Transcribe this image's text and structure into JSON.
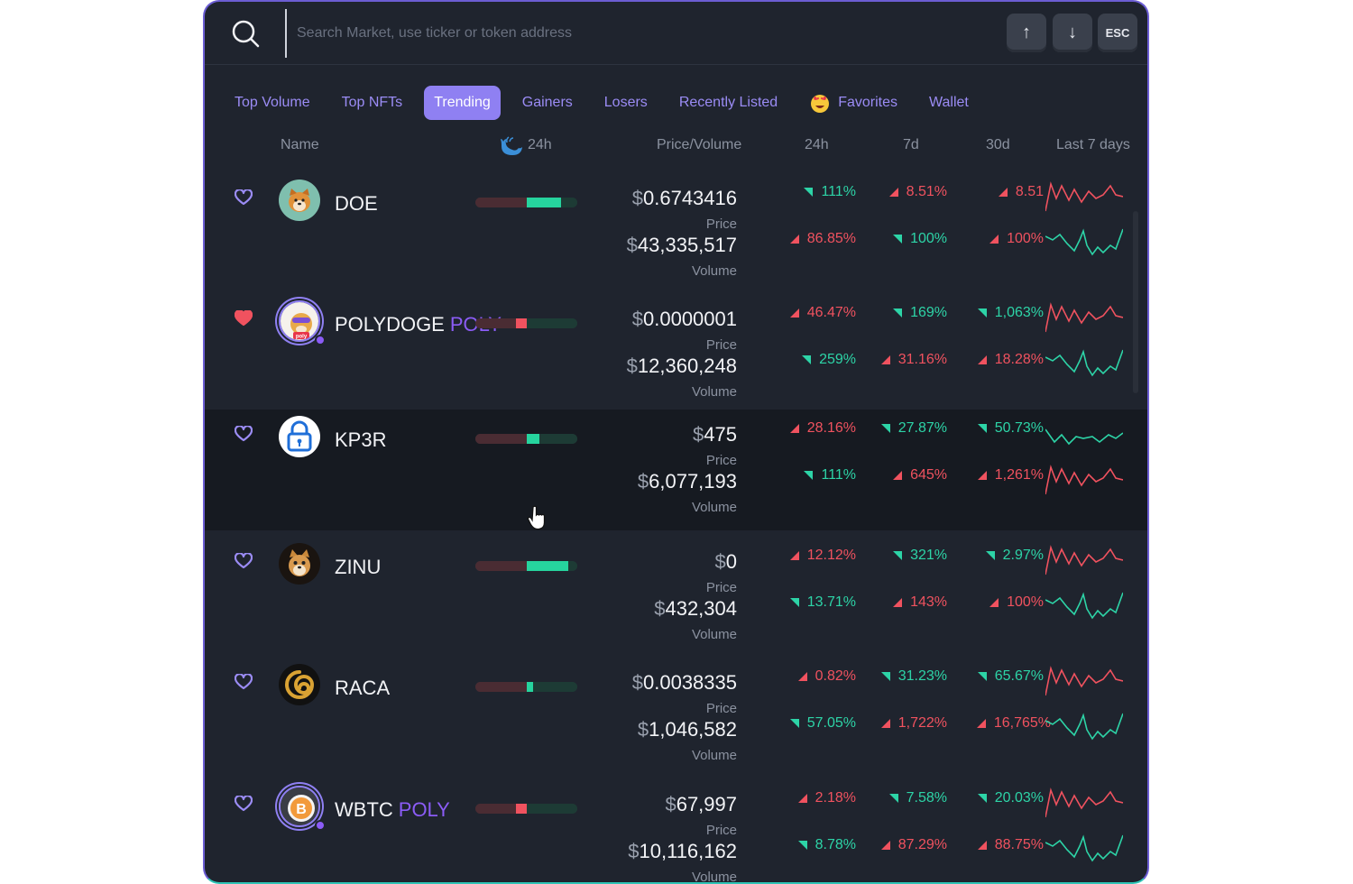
{
  "search": {
    "placeholder": "Search Market, use ticker or token address"
  },
  "keys": {
    "up": "↑",
    "down": "↓",
    "esc": "ESC"
  },
  "tabs": [
    {
      "label": "Top Volume"
    },
    {
      "label": "Top NFTs"
    },
    {
      "label": "Trending",
      "active": true
    },
    {
      "label": "Gainers"
    },
    {
      "label": "Losers"
    },
    {
      "label": "Recently Listed"
    },
    {
      "label": "Favorites",
      "icon": "heart-eyes-emoji-icon"
    },
    {
      "label": "Wallet"
    }
  ],
  "columns": {
    "name": "Name",
    "whale24h": "24h",
    "price_volume": "Price/Volume",
    "d24": "24h",
    "d7": "7d",
    "d30": "30d",
    "last7": "Last 7 days"
  },
  "labels": {
    "price": "Price",
    "volume": "Volume"
  },
  "colors": {
    "accent": "#8f80f2",
    "up": "#2dd4a7",
    "down": "#f0525f",
    "chain": "#8b5cf6",
    "background": "#1f242e"
  },
  "rows": [
    {
      "name": "DOE",
      "chain": "",
      "favorite": false,
      "icon": "shiba-dog-icon",
      "bar_buy_fraction": 0.34,
      "bar_sell_fraction": 0.5,
      "price": "0.6743416",
      "volume": "43,335,517",
      "price_changes": [
        {
          "v": "111%",
          "dir": "up"
        },
        {
          "v": "8.51%",
          "dir": "down"
        },
        {
          "v": "8.51",
          "dir": "down"
        }
      ],
      "volume_changes": [
        {
          "v": "86.85%",
          "dir": "down"
        },
        {
          "v": "100%",
          "dir": "up"
        },
        {
          "v": "100%",
          "dir": "down"
        }
      ],
      "spark_price": "down",
      "spark_volume": "up"
    },
    {
      "name": "POLYDOGE",
      "chain": "POLY",
      "favorite": true,
      "icon": "polydoge-icon",
      "bar_buy_fraction": 0.0,
      "bar_sell_fraction": 0.5,
      "price": "0.0000001",
      "volume": "12,360,248",
      "price_changes": [
        {
          "v": "46.47%",
          "dir": "down"
        },
        {
          "v": "169%",
          "dir": "up"
        },
        {
          "v": "1,063%",
          "dir": "up"
        }
      ],
      "volume_changes": [
        {
          "v": "259%",
          "dir": "up"
        },
        {
          "v": "31.16%",
          "dir": "down"
        },
        {
          "v": "18.28%",
          "dir": "down"
        }
      ],
      "spark_price": "down",
      "spark_volume": "up"
    },
    {
      "name": "KP3R",
      "chain": "",
      "favorite": false,
      "icon": "padlock-icon",
      "bar_buy_fraction": 0.12,
      "bar_sell_fraction": 0.5,
      "price": "475",
      "volume": "6,077,193",
      "price_changes": [
        {
          "v": "28.16%",
          "dir": "down"
        },
        {
          "v": "27.87%",
          "dir": "up"
        },
        {
          "v": "50.73%",
          "dir": "up"
        }
      ],
      "volume_changes": [
        {
          "v": "111%",
          "dir": "up"
        },
        {
          "v": "645%",
          "dir": "down"
        },
        {
          "v": "1,261%",
          "dir": "down"
        }
      ],
      "spark_price": "up",
      "spark_volume": "down"
    },
    {
      "name": "ZINU",
      "chain": "",
      "favorite": false,
      "icon": "zinu-dog-icon",
      "bar_buy_fraction": 0.41,
      "bar_sell_fraction": 0.5,
      "price": "0",
      "volume": "432,304",
      "price_changes": [
        {
          "v": "12.12%",
          "dir": "down"
        },
        {
          "v": "321%",
          "dir": "up"
        },
        {
          "v": "2.97%",
          "dir": "up"
        }
      ],
      "volume_changes": [
        {
          "v": "13.71%",
          "dir": "up"
        },
        {
          "v": "143%",
          "dir": "down"
        },
        {
          "v": "100%",
          "dir": "down"
        }
      ],
      "spark_price": "down",
      "spark_volume": "up"
    },
    {
      "name": "RACA",
      "chain": "",
      "favorite": false,
      "icon": "raca-swirl-icon",
      "bar_buy_fraction": 0.06,
      "bar_sell_fraction": 0.5,
      "price": "0.0038335",
      "volume": "1,046,582",
      "price_changes": [
        {
          "v": "0.82%",
          "dir": "down"
        },
        {
          "v": "31.23%",
          "dir": "up"
        },
        {
          "v": "65.67%",
          "dir": "up"
        }
      ],
      "volume_changes": [
        {
          "v": "57.05%",
          "dir": "up"
        },
        {
          "v": "1,722%",
          "dir": "down"
        },
        {
          "v": "16,765%",
          "dir": "down"
        }
      ],
      "spark_price": "down",
      "spark_volume": "up"
    },
    {
      "name": "WBTC",
      "chain": "POLY",
      "favorite": false,
      "icon": "bitcoin-icon",
      "bar_buy_fraction": 0.0,
      "bar_sell_fraction": 0.5,
      "price": "67,997",
      "volume": "10,116,162",
      "price_changes": [
        {
          "v": "2.18%",
          "dir": "down"
        },
        {
          "v": "7.58%",
          "dir": "up"
        },
        {
          "v": "20.03%",
          "dir": "up"
        }
      ],
      "volume_changes": [
        {
          "v": "8.78%",
          "dir": "up"
        },
        {
          "v": "87.29%",
          "dir": "down"
        },
        {
          "v": "88.75%",
          "dir": "down"
        }
      ],
      "spark_price": "down",
      "spark_volume": "up"
    }
  ]
}
